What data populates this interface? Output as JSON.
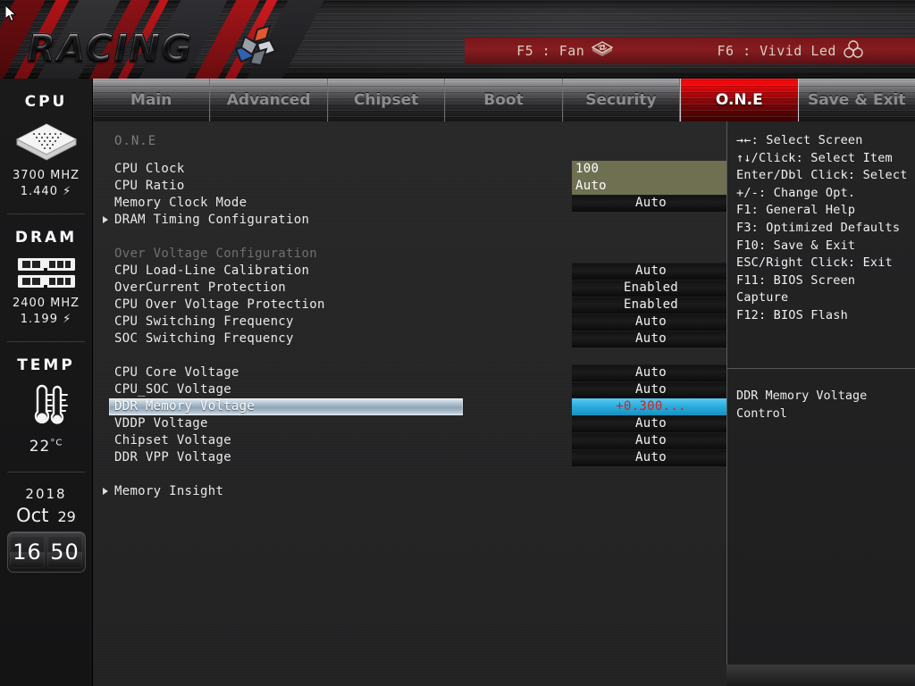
{
  "banner": {
    "logo_text": "RACING",
    "logo_emblem_icon": "racing-x-emblem-icon",
    "fkeys": [
      {
        "label": "F5 : Fan",
        "icon": "fan-icon"
      },
      {
        "label": "F6 : Vivid Led",
        "icon": "led-icon"
      }
    ]
  },
  "tabs": [
    {
      "label": "Main",
      "active": false
    },
    {
      "label": "Advanced",
      "active": false
    },
    {
      "label": "Chipset",
      "active": false
    },
    {
      "label": "Boot",
      "active": false
    },
    {
      "label": "Security",
      "active": false
    },
    {
      "label": "O.N.E",
      "active": true
    },
    {
      "label": "Save & Exit",
      "active": false
    }
  ],
  "sidebar": {
    "cpu": {
      "title": "CPU",
      "icon": "cpu-chip-icon",
      "freq": "3700 MHZ",
      "volt": "1.440"
    },
    "dram": {
      "title": "DRAM",
      "icon": "dram-module-icon",
      "freq": "2400 MHZ",
      "volt": "1.199"
    },
    "temp": {
      "title": "TEMP",
      "icon": "thermometer-icon",
      "value": "22",
      "unit": "°C"
    },
    "datetime": {
      "year": "2018",
      "month": "Oct",
      "day": "29",
      "clock_hours": "16",
      "clock_minutes": "50"
    }
  },
  "main": {
    "heading": "O.N.E",
    "rows": [
      {
        "label": "CPU Clock",
        "value": "100",
        "style": "edit",
        "arrow": false,
        "dim": false,
        "selected": false
      },
      {
        "label": "CPU Ratio",
        "value": "Auto",
        "style": "edit",
        "arrow": false,
        "dim": false,
        "selected": false
      },
      {
        "label": "Memory Clock Mode",
        "value": "Auto",
        "style": "opt",
        "arrow": false,
        "dim": false,
        "selected": false
      },
      {
        "label": "DRAM Timing Configuration",
        "value": "",
        "style": "none",
        "arrow": true,
        "dim": false,
        "selected": false
      },
      {
        "label": "",
        "value": "",
        "style": "none",
        "arrow": false,
        "dim": false,
        "selected": false
      },
      {
        "label": "Over Voltage Configuration",
        "value": "",
        "style": "none",
        "arrow": false,
        "dim": true,
        "selected": false
      },
      {
        "label": "CPU Load-Line Calibration",
        "value": "Auto",
        "style": "opt",
        "arrow": false,
        "dim": false,
        "selected": false
      },
      {
        "label": "OverCurrent Protection",
        "value": "Enabled",
        "style": "opt",
        "arrow": false,
        "dim": false,
        "selected": false
      },
      {
        "label": "CPU Over Voltage Protection",
        "value": "Enabled",
        "style": "opt",
        "arrow": false,
        "dim": false,
        "selected": false
      },
      {
        "label": "CPU Switching Frequency",
        "value": "Auto",
        "style": "opt",
        "arrow": false,
        "dim": false,
        "selected": false
      },
      {
        "label": "SOC Switching Frequency",
        "value": "Auto",
        "style": "opt",
        "arrow": false,
        "dim": false,
        "selected": false
      },
      {
        "label": "",
        "value": "",
        "style": "none",
        "arrow": false,
        "dim": false,
        "selected": false
      },
      {
        "label": "CPU Core Voltage",
        "value": "Auto",
        "style": "opt",
        "arrow": false,
        "dim": false,
        "selected": false
      },
      {
        "label": "CPU_SOC Voltage",
        "value": "Auto",
        "style": "opt",
        "arrow": false,
        "dim": false,
        "selected": false
      },
      {
        "label": "DDR Memory Voltage",
        "value": "+0.300...",
        "style": "hl",
        "arrow": false,
        "dim": false,
        "selected": true
      },
      {
        "label": "VDDP Voltage",
        "value": "Auto",
        "style": "opt",
        "arrow": false,
        "dim": false,
        "selected": false
      },
      {
        "label": "Chipset Voltage",
        "value": "Auto",
        "style": "opt",
        "arrow": false,
        "dim": false,
        "selected": false
      },
      {
        "label": "DDR VPP Voltage",
        "value": "Auto",
        "style": "opt",
        "arrow": false,
        "dim": false,
        "selected": false
      },
      {
        "label": "",
        "value": "",
        "style": "none",
        "arrow": false,
        "dim": false,
        "selected": false
      },
      {
        "label": "Memory Insight",
        "value": "",
        "style": "none",
        "arrow": true,
        "dim": false,
        "selected": false
      }
    ]
  },
  "help": {
    "keys": [
      "→←: Select Screen",
      "↑↓/Click: Select Item",
      "Enter/Dbl Click: Select",
      "+/-: Change Opt.",
      "F1: General Help",
      "F3: Optimized Defaults",
      "F10: Save & Exit",
      "ESC/Right Click: Exit",
      "F11: BIOS Screen",
      "Capture",
      "F12: BIOS Flash"
    ],
    "description": "DDR Memory Voltage Control"
  },
  "colors": {
    "accent_red": "#ff0b0b",
    "selection_blue": "#29afe0",
    "selection_value_text": "#d4211c",
    "edit_field_olive": "#6e7051",
    "row_select_gradient_top": "#e9eff4"
  }
}
